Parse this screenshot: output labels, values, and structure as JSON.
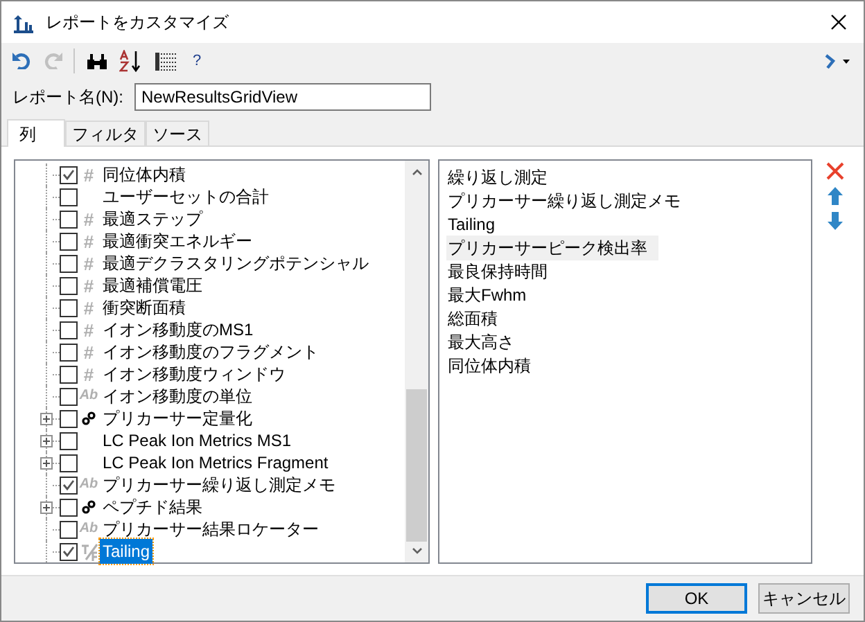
{
  "window": {
    "title": "レポートをカスタマイズ"
  },
  "name_field": {
    "label": "レポート名(N):",
    "value": "NewResultsGridView"
  },
  "tabs": [
    {
      "label": "列",
      "selected": true
    },
    {
      "label": "フィルタ",
      "selected": false
    },
    {
      "label": "ソース",
      "selected": false
    }
  ],
  "tree": [
    {
      "label": "同位体内積",
      "kind": "number",
      "type_label": "#",
      "checked": true,
      "selected": false
    },
    {
      "label": "ユーザーセットの合計",
      "kind": "none",
      "checked": false,
      "selected": false
    },
    {
      "label": "最適ステップ",
      "kind": "number",
      "type_label": "#",
      "checked": false,
      "selected": false
    },
    {
      "label": "最適衝突エネルギー",
      "kind": "number",
      "type_label": "#",
      "checked": false,
      "selected": false
    },
    {
      "label": "最適デクラスタリングポテンシャル",
      "kind": "number",
      "type_label": "#",
      "checked": false,
      "selected": false
    },
    {
      "label": "最適補償電圧",
      "kind": "number",
      "type_label": "#",
      "checked": false,
      "selected": false
    },
    {
      "label": "衝突断面積",
      "kind": "number",
      "type_label": "#",
      "checked": false,
      "selected": false
    },
    {
      "label": "イオン移動度のMS1",
      "kind": "number",
      "type_label": "#",
      "checked": false,
      "selected": false
    },
    {
      "label": "イオン移動度のフラグメント",
      "kind": "number",
      "type_label": "#",
      "checked": false,
      "selected": false
    },
    {
      "label": "イオン移動度ウィンドウ",
      "kind": "number",
      "type_label": "#",
      "checked": false,
      "selected": false
    },
    {
      "label": "イオン移動度の単位",
      "kind": "text",
      "type_label": "Ab",
      "checked": false,
      "selected": false
    },
    {
      "label": "プリカーサー定量化",
      "kind": "link",
      "checked": false,
      "selected": false,
      "expanded": false
    },
    {
      "label": "LC Peak Ion Metrics MS1",
      "kind": "none",
      "checked": false,
      "selected": false,
      "expanded": false
    },
    {
      "label": "LC Peak Ion Metrics Fragment",
      "kind": "none",
      "checked": false,
      "selected": false,
      "expanded": false
    },
    {
      "label": "プリカーサー繰り返し測定メモ",
      "kind": "text",
      "type_label": "Ab",
      "checked": true,
      "selected": false
    },
    {
      "label": "ペプチド結果",
      "kind": "link",
      "checked": false,
      "selected": false,
      "expanded": false
    },
    {
      "label": "プリカーサー結果ロケーター",
      "kind": "text",
      "type_label": "Ab",
      "checked": false,
      "selected": false
    },
    {
      "label": "Tailing",
      "kind": "tf",
      "checked": true,
      "selected": true
    }
  ],
  "columns": [
    {
      "label": "繰り返し測定",
      "selected": false
    },
    {
      "label": "プリカーサー繰り返し測定メモ",
      "selected": false
    },
    {
      "label": "Tailing",
      "selected": false
    },
    {
      "label": "プリカーサーピーク検出率",
      "selected": true
    },
    {
      "label": "最良保持時間",
      "selected": false
    },
    {
      "label": "最大Fwhm",
      "selected": false
    },
    {
      "label": "総面積",
      "selected": false
    },
    {
      "label": "最大高さ",
      "selected": false
    },
    {
      "label": "同位体内積",
      "selected": false
    }
  ],
  "buttons": [
    {
      "label": "OK",
      "kind": "default"
    },
    {
      "label": "キャンセル",
      "kind": "normal"
    }
  ],
  "help": "?"
}
